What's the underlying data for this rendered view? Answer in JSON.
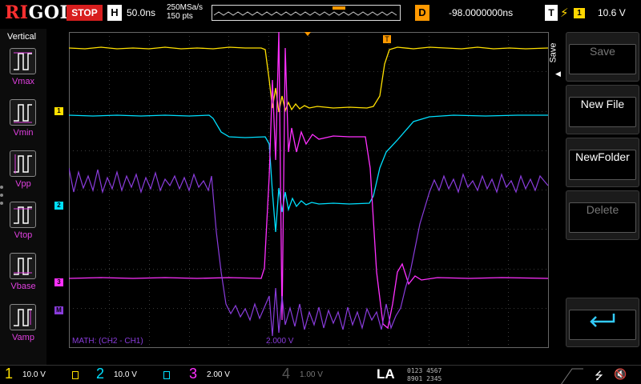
{
  "header": {
    "brand_red": "RI",
    "brand_rest": "GOL",
    "run_state": "STOP",
    "timebase_key": "H",
    "timebase": "50.0ns",
    "sample_rate": "250MSa/s",
    "memory_depth": "150 pts",
    "delay_key": "D",
    "delay": "-98.0000000ns",
    "trigger_key": "T",
    "trigger_edge_icon": "rising-edge-icon",
    "trigger_source": "1",
    "trigger_level": "10.6 V"
  },
  "left_panel": {
    "title": "Vertical",
    "items": [
      {
        "label": "Vmax",
        "icon": "vmax-icon"
      },
      {
        "label": "Vmin",
        "icon": "vmin-icon"
      },
      {
        "label": "Vpp",
        "icon": "vpp-icon"
      },
      {
        "label": "Vtop",
        "icon": "vtop-icon"
      },
      {
        "label": "Vbase",
        "icon": "vbase-icon"
      },
      {
        "label": "Vamp",
        "icon": "vamp-icon"
      }
    ]
  },
  "right_menu": {
    "tab": "Save",
    "items": [
      {
        "label": "Save",
        "enabled": false
      },
      {
        "label": "New File",
        "enabled": true
      },
      {
        "label": "NewFolder",
        "enabled": true
      },
      {
        "label": "Delete",
        "enabled": false
      },
      {
        "label": "",
        "icon": "enter-icon",
        "enabled": true
      }
    ]
  },
  "markers": {
    "ch1": "1",
    "ch2": "2",
    "ch3": "3",
    "math": "M",
    "trigger": "T"
  },
  "math": {
    "label": "MATH: (CH2 - CH1)",
    "scale": "2.000 V"
  },
  "channels": [
    {
      "num": "1",
      "scale": "10.0 V",
      "color": "#ffe000"
    },
    {
      "num": "2",
      "scale": "10.0 V",
      "color": "#00e0ff"
    },
    {
      "num": "3",
      "scale": "2.00 V",
      "color": "#ff30ff"
    },
    {
      "num": "4",
      "scale": "1.00 V",
      "color": "#6f7fff"
    }
  ],
  "la": {
    "label": "LA",
    "row1": "0123 4567",
    "row2": "8901 2345"
  },
  "status_icons": [
    "usb-icon",
    "speaker-off-icon"
  ],
  "colors": {
    "ch1": "#ffe000",
    "ch2": "#00e0ff",
    "ch3": "#ff30ff",
    "math": "#8a3cdc",
    "trigger": "#ff9900",
    "stop": "#d81e1e"
  }
}
